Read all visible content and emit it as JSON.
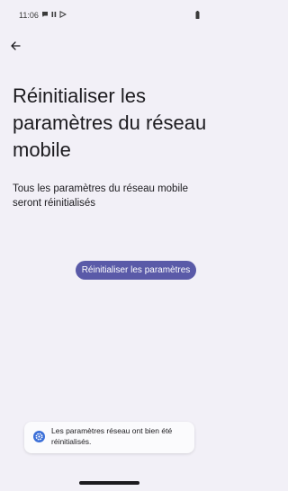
{
  "status_bar": {
    "time": "11:06",
    "icons": [
      "chat-icon",
      "pause-icon",
      "play-store-icon",
      "battery-icon"
    ]
  },
  "header": {
    "back_icon": "arrow-back-icon"
  },
  "main": {
    "title": "Réinitialiser les paramètres du réseau mobile",
    "description": "Tous les paramètres du réseau mobile seront réinitialisés",
    "reset_button_label": "Réinitialiser les paramètres"
  },
  "toast": {
    "icon": "settings-gear-icon",
    "message": "Les paramètres réseau ont bien été réinitialisés."
  },
  "colors": {
    "background": "#f2f0f7",
    "accent": "#5a5aa8",
    "toast_bg": "#fbfbfd",
    "toast_icon": "#3b6fd8"
  }
}
